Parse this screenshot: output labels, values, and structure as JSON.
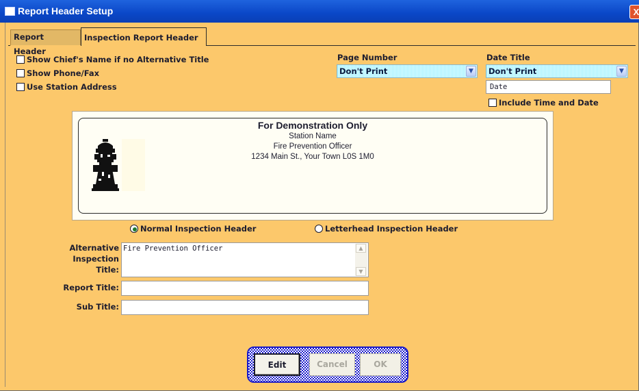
{
  "window": {
    "title": "Report Header Setup",
    "close_glyph": "X"
  },
  "tabs": [
    {
      "label": "Report Header",
      "active": false
    },
    {
      "label": "Inspection Report Header",
      "active": true
    }
  ],
  "options": {
    "show_chief_name": {
      "label": "Show Chief's Name if no Alternative Title",
      "checked": false
    },
    "show_phone_fax": {
      "label": "Show Phone/Fax",
      "checked": false
    },
    "use_station_address": {
      "label": "Use Station Address",
      "checked": false
    }
  },
  "page_number": {
    "label": "Page Number",
    "selected": "Don't Print"
  },
  "date_title": {
    "label": "Date Title",
    "selected": "Don't Print",
    "text_value": "Date",
    "include_time": {
      "label": "Include Time and Date",
      "checked": false
    }
  },
  "preview": {
    "title": "For Demonstration Only",
    "lines": [
      "Station Name",
      "Fire Prevention Officer",
      "1234 Main St., Your Town L0S 1M0"
    ],
    "logo_icon": "fire-hydrant-icon"
  },
  "header_type": {
    "normal": {
      "label": "Normal Inspection Header",
      "selected": true
    },
    "letterhead": {
      "label": "Letterhead Inspection Header",
      "selected": false
    }
  },
  "fields": {
    "alt_title": {
      "label_lines": [
        "Alternative",
        "Inspection",
        "Title:"
      ],
      "value": "Fire Prevention Officer"
    },
    "report_title": {
      "label": "Report Title:",
      "value": ""
    },
    "sub_title": {
      "label": "Sub Title:",
      "value": ""
    }
  },
  "buttons": {
    "edit": "Edit",
    "cancel": "Cancel",
    "ok": "OK"
  },
  "colors": {
    "background": "#fcc86b",
    "titlebar": "#0a47c7",
    "dropdown": "#a6f2ff",
    "button_frame": "#1a1acc"
  }
}
